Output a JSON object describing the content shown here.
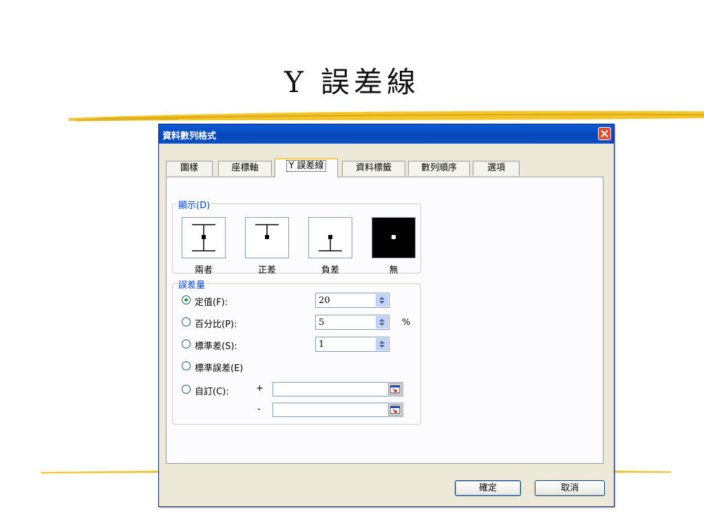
{
  "slide": {
    "title": "Y 誤差線"
  },
  "dialog": {
    "title": "資料數列格式",
    "tabs": [
      {
        "label": "圖樣",
        "active": false
      },
      {
        "label": "座標軸",
        "active": false
      },
      {
        "label": "Y 誤差線",
        "active": true
      },
      {
        "label": "資料標籤",
        "active": false
      },
      {
        "label": "數列順序",
        "active": false
      },
      {
        "label": "選項",
        "active": false
      }
    ],
    "display": {
      "title": "顯示(D)",
      "options": [
        {
          "label": "兩者",
          "selected": false
        },
        {
          "label": "正差",
          "selected": false
        },
        {
          "label": "負差",
          "selected": false
        },
        {
          "label": "無",
          "selected": true
        }
      ]
    },
    "amount": {
      "title": "誤差量",
      "fixed": {
        "label": "定值(F):",
        "value": "20",
        "selected": true
      },
      "percent": {
        "label": "百分比(P):",
        "value": "5",
        "unit": "%",
        "selected": false
      },
      "stdev": {
        "label": "標準差(S):",
        "value": "1",
        "selected": false
      },
      "stderr": {
        "label": "標準誤差(E)",
        "selected": false
      },
      "custom": {
        "label": "自訂(C):",
        "plus": "+",
        "minus": "-",
        "plus_value": "",
        "minus_value": "",
        "selected": false
      }
    },
    "buttons": {
      "ok": "確定",
      "cancel": "取消"
    }
  },
  "colors": {
    "title_bar": "#0a5bd8",
    "close_button": "#e04e2c",
    "group_title": "#0046d5",
    "tab_highlight": "#ffc83c",
    "radio_dot": "#21a121",
    "brush_stroke": "#f2c21d"
  }
}
